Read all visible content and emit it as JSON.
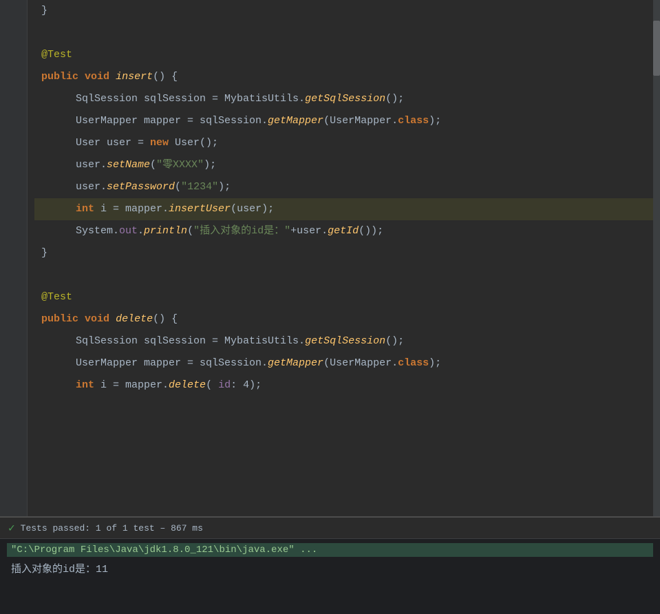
{
  "editor": {
    "background": "#2b2b2b",
    "lines": [
      {
        "id": "closing-brace-top",
        "indent": 0,
        "tokens": [
          {
            "type": "default",
            "text": "}"
          }
        ],
        "highlighted": false
      },
      {
        "id": "blank-1",
        "indent": 0,
        "tokens": [],
        "highlighted": false
      },
      {
        "id": "annotation-test-1",
        "indent": 0,
        "tokens": [
          {
            "type": "annotation",
            "text": "@Test"
          }
        ],
        "highlighted": false
      },
      {
        "id": "method-insert-sig",
        "indent": 0,
        "tokens": [
          {
            "type": "keyword",
            "text": "public"
          },
          {
            "type": "default",
            "text": " "
          },
          {
            "type": "keyword",
            "text": "void"
          },
          {
            "type": "default",
            "text": " "
          },
          {
            "type": "method",
            "text": "insert"
          },
          {
            "type": "default",
            "text": "() {"
          }
        ],
        "highlighted": false
      },
      {
        "id": "sqlsession-line-1",
        "indent": 1,
        "tokens": [
          {
            "type": "default",
            "text": "SqlSession sqlSession = MybatisUtils."
          },
          {
            "type": "method",
            "text": "getSqlSession"
          },
          {
            "type": "default",
            "text": "();"
          }
        ],
        "highlighted": false
      },
      {
        "id": "usermapper-line-1",
        "indent": 1,
        "tokens": [
          {
            "type": "default",
            "text": "UserMapper mapper = sqlSession."
          },
          {
            "type": "method",
            "text": "getMapper"
          },
          {
            "type": "default",
            "text": "(UserMapper."
          },
          {
            "type": "keyword",
            "text": "class"
          },
          {
            "type": "default",
            "text": ");"
          }
        ],
        "highlighted": false
      },
      {
        "id": "user-new-line",
        "indent": 1,
        "tokens": [
          {
            "type": "default",
            "text": "User user = "
          },
          {
            "type": "keyword",
            "text": "new"
          },
          {
            "type": "default",
            "text": " User();"
          }
        ],
        "highlighted": false
      },
      {
        "id": "setname-line",
        "indent": 1,
        "tokens": [
          {
            "type": "default",
            "text": "user."
          },
          {
            "type": "method",
            "text": "setName"
          },
          {
            "type": "default",
            "text": "("
          },
          {
            "type": "string",
            "text": "\"零XXXX\""
          },
          {
            "type": "default",
            "text": ");"
          }
        ],
        "highlighted": false
      },
      {
        "id": "setpassword-line",
        "indent": 1,
        "tokens": [
          {
            "type": "default",
            "text": "user."
          },
          {
            "type": "method",
            "text": "setPassword"
          },
          {
            "type": "default",
            "text": "("
          },
          {
            "type": "string",
            "text": "\"1234\""
          },
          {
            "type": "default",
            "text": ");"
          }
        ],
        "highlighted": false
      },
      {
        "id": "int-insert-line",
        "indent": 1,
        "tokens": [
          {
            "type": "keyword",
            "text": "int"
          },
          {
            "type": "default",
            "text": " i = mapper."
          },
          {
            "type": "method",
            "text": "insertUser"
          },
          {
            "type": "default",
            "text": "(user);"
          }
        ],
        "highlighted": true
      },
      {
        "id": "system-println-line",
        "indent": 1,
        "tokens": [
          {
            "type": "default",
            "text": "System."
          },
          {
            "type": "field",
            "text": "out"
          },
          {
            "type": "default",
            "text": "."
          },
          {
            "type": "method",
            "text": "println"
          },
          {
            "type": "default",
            "text": "("
          },
          {
            "type": "string",
            "text": "\"插入对象的id是：\""
          },
          {
            "type": "default",
            "text": "+user."
          },
          {
            "type": "method",
            "text": "getId"
          },
          {
            "type": "default",
            "text": "());"
          }
        ],
        "highlighted": false
      },
      {
        "id": "closing-brace-1",
        "indent": 0,
        "tokens": [
          {
            "type": "default",
            "text": "}"
          }
        ],
        "highlighted": false
      },
      {
        "id": "blank-2",
        "indent": 0,
        "tokens": [],
        "highlighted": false
      },
      {
        "id": "annotation-test-2",
        "indent": 0,
        "tokens": [
          {
            "type": "annotation",
            "text": "@Test"
          }
        ],
        "highlighted": false
      },
      {
        "id": "method-delete-sig",
        "indent": 0,
        "tokens": [
          {
            "type": "keyword",
            "text": "public"
          },
          {
            "type": "default",
            "text": " "
          },
          {
            "type": "keyword",
            "text": "void"
          },
          {
            "type": "default",
            "text": " "
          },
          {
            "type": "method",
            "text": "delete"
          },
          {
            "type": "default",
            "text": "() {"
          }
        ],
        "highlighted": false
      },
      {
        "id": "sqlsession-line-2",
        "indent": 1,
        "tokens": [
          {
            "type": "default",
            "text": "SqlSession sqlSession = MybatisUtils."
          },
          {
            "type": "method",
            "text": "getSqlSession"
          },
          {
            "type": "default",
            "text": "();"
          }
        ],
        "highlighted": false
      },
      {
        "id": "usermapper-line-2",
        "indent": 1,
        "tokens": [
          {
            "type": "default",
            "text": "UserMapper mapper = sqlSession."
          },
          {
            "type": "method",
            "text": "getMapper"
          },
          {
            "type": "default",
            "text": "(UserMapper."
          },
          {
            "type": "keyword",
            "text": "class"
          },
          {
            "type": "default",
            "text": ");"
          }
        ],
        "highlighted": false
      },
      {
        "id": "int-delete-line",
        "indent": 1,
        "tokens": [
          {
            "type": "keyword",
            "text": "int"
          },
          {
            "type": "default",
            "text": " i = mapper."
          },
          {
            "type": "method",
            "text": "delete"
          },
          {
            "type": "default",
            "text": "( "
          },
          {
            "type": "field",
            "text": "id"
          },
          {
            "type": "default",
            "text": ": 4);"
          }
        ],
        "highlighted": false
      }
    ]
  },
  "bottom_panel": {
    "test_status": {
      "icon": "✓",
      "text": "Tests passed: ",
      "highlight": "1 of 1 test",
      "suffix": " – 867 ms"
    },
    "console_cmd": "\"C:\\Program Files\\Java\\jdk1.8.0_121\\bin\\java.exe\" ...",
    "console_output": "插入对象的id是：11"
  }
}
